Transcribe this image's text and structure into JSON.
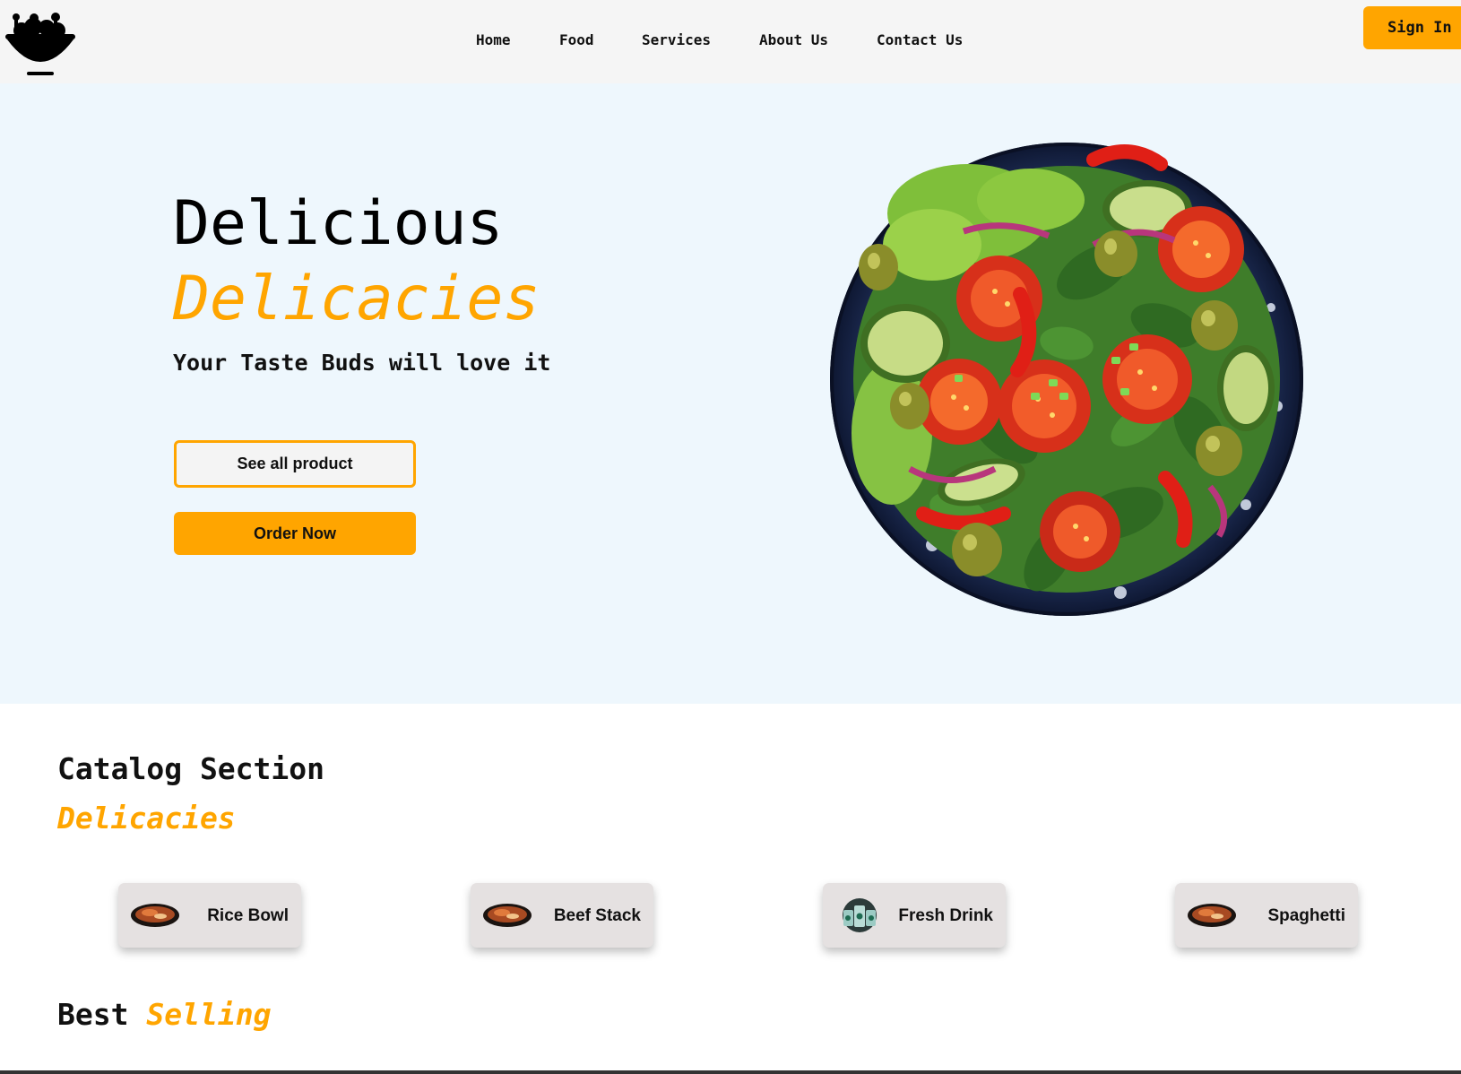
{
  "nav": {
    "logo_icon": "salad-bowl-icon",
    "links": [
      "Home",
      "Food",
      "Services",
      "About Us",
      "Contact Us"
    ],
    "signin_label": "Sign In"
  },
  "hero": {
    "title": "Delicious",
    "accent": "Delicacies",
    "subtitle": "Your Taste Buds will love it",
    "see_all_label": "See all product",
    "order_label": "Order Now",
    "image_icon": "salad-bowl-image"
  },
  "catalog": {
    "title": "Catalog Section",
    "accent": "Delicacies",
    "items": [
      {
        "label": "Rice Bowl",
        "icon": "rice-bowl-thumbnail"
      },
      {
        "label": "Beef Stack",
        "icon": "beef-stack-thumbnail"
      },
      {
        "label": "Fresh Drink",
        "icon": "fresh-drink-thumbnail"
      },
      {
        "label": "Spaghetti",
        "icon": "spaghetti-thumbnail"
      }
    ]
  },
  "best_selling": {
    "title": "Best",
    "accent": "Selling"
  },
  "colors": {
    "accent": "#FFA500",
    "hero_bg": "#eef7fd",
    "nav_bg": "#f5f5f5",
    "card_bg": "#e5e1e1"
  }
}
